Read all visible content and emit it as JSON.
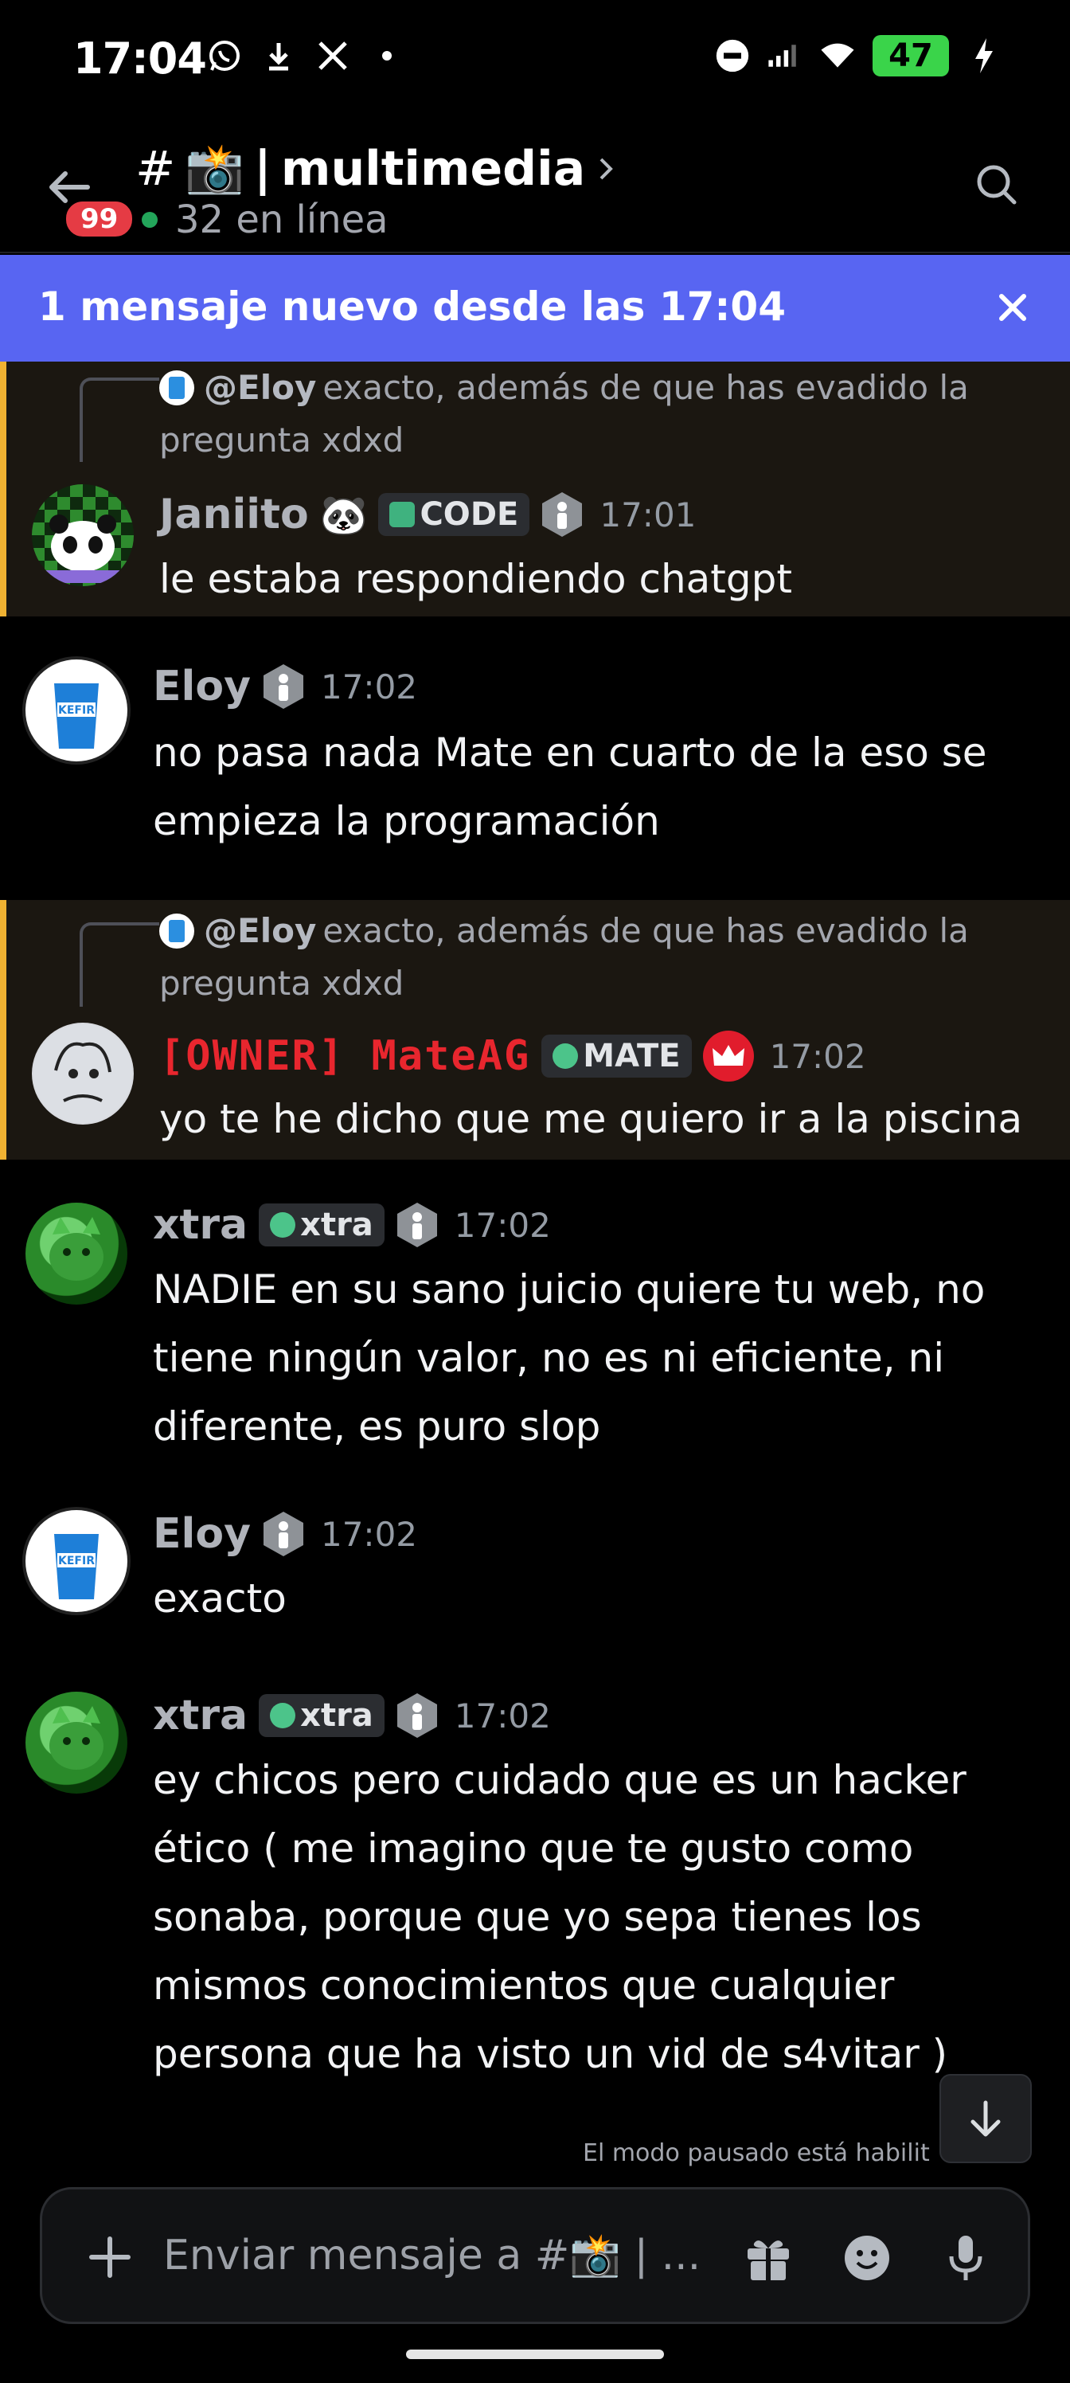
{
  "status_bar": {
    "time": "17:04",
    "battery": "47",
    "left_icons": [
      "whatsapp-icon",
      "download-icon",
      "x-icon",
      "dot-icon"
    ],
    "right_icons": [
      "dnd-icon",
      "signal-icon",
      "wifi-icon",
      "battery-icon",
      "charging-icon"
    ]
  },
  "header": {
    "unread_count": "99",
    "hash": "#",
    "channel_emoji": "📸",
    "separator": "|",
    "channel_name": "multimedia",
    "online_text": "32 en línea"
  },
  "new_messages_banner": {
    "text": "1 mensaje nuevo desde las 17:04"
  },
  "messages": [
    {
      "reply": {
        "author": "@Eloy",
        "text": "exacto, además de que has evadido la pregunta xdxd"
      },
      "author": "Janiito",
      "author_emoji": "🐼",
      "tag": "CODE",
      "timestamp": "17:01",
      "content": "le estaba respondiendo chatgpt"
    },
    {
      "author": "Eloy",
      "timestamp": "17:02",
      "content": "no pasa nada Mate en cuarto de la eso se empieza la programación"
    },
    {
      "reply": {
        "author": "@Eloy",
        "text": "exacto, además de que has evadido la pregunta xdxd"
      },
      "author": "[OWNER] MateAG",
      "tag": "MATE",
      "timestamp": "17:02",
      "content": "yo te he dicho que me quiero ir a la piscina"
    },
    {
      "author": "xtra",
      "tag": "xtra",
      "timestamp": "17:02",
      "content": "NADIE en su sano juicio quiere tu web, no tiene ningún valor, no es ni eficiente, ni diferente, es puro slop"
    },
    {
      "author": "Eloy",
      "timestamp": "17:02",
      "content": "exacto"
    },
    {
      "author": "xtra",
      "tag": "xtra",
      "timestamp": "17:02",
      "content": "ey chicos pero cuidado que es un hacker ético ( me imagino que te gusto como sonaba, porque que yo sepa tienes los mismos conocimientos que cualquier persona que ha visto un vid de s4vitar )"
    }
  ],
  "paused_note": "El modo pausado está habilit",
  "input": {
    "placeholder": "Enviar mensaje a #📸 | ..."
  },
  "colors": {
    "blurple": "#5865f2",
    "highlight_bar": "#f0b232",
    "owner_red": "#e8262e",
    "online_green": "#23a55a",
    "badge_red": "#e53b44"
  }
}
